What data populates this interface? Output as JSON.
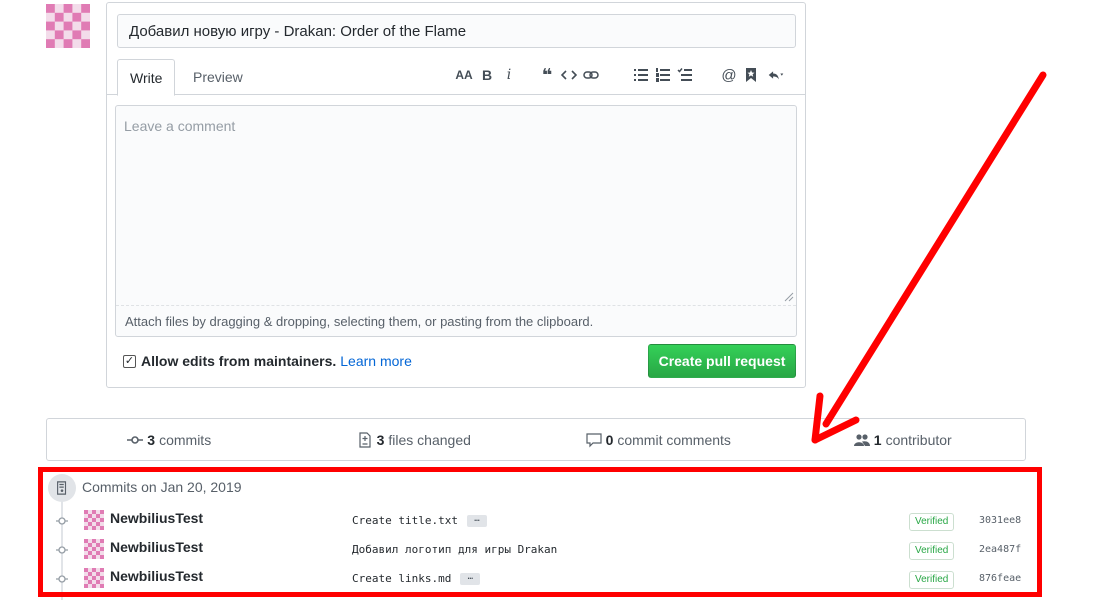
{
  "pr_form": {
    "title_value": "Добавил новую игру - Drakan: Order of the Flame",
    "tabs": [
      "Write",
      "Preview"
    ],
    "toolbar_icons": [
      "text-size-icon",
      "bold-icon",
      "italic-icon",
      "quote-icon",
      "code-icon",
      "link-icon",
      "bullet-list-icon",
      "numbered-list-icon",
      "task-list-icon",
      "mention-icon",
      "bookmark-icon",
      "reply-icon"
    ],
    "toolbar_labels": {
      "text_size": "AA",
      "bold": "B",
      "italic": "i",
      "quote": "❝",
      "mention": "@"
    },
    "comment_placeholder": "Leave a comment",
    "attach_hint": "Attach files by dragging & dropping, selecting them, or pasting from the clipboard.",
    "allow_edits_label": "Allow edits from maintainers.",
    "learn_more": "Learn more",
    "allow_edits_checked": true,
    "create_button": "Create pull request"
  },
  "stats": {
    "commits_count": "3",
    "commits_label": "commits",
    "files_count": "3",
    "files_label": "files changed",
    "comments_count": "0",
    "comments_label": "commit comments",
    "contributors_count": "1",
    "contributors_label": "contributor"
  },
  "commit_group": {
    "title": "Commits on Jan 20, 2019",
    "commits": [
      {
        "author": "NewbiliusTest",
        "message": "Create title.txt",
        "has_more": true,
        "verified": "Verified",
        "sha": "3031ee8"
      },
      {
        "author": "NewbiliusTest",
        "message": "Добавил логотип для игры Drakan",
        "has_more": false,
        "verified": "Verified",
        "sha": "2ea487f"
      },
      {
        "author": "NewbiliusTest",
        "message": "Create links.md",
        "has_more": true,
        "verified": "Verified",
        "sha": "876feae"
      }
    ]
  },
  "colors": {
    "accent_green": "#28a745",
    "annotation_red": "#ff0000",
    "avatar_pink": "#e07bb4",
    "link_blue": "#0366d6"
  }
}
